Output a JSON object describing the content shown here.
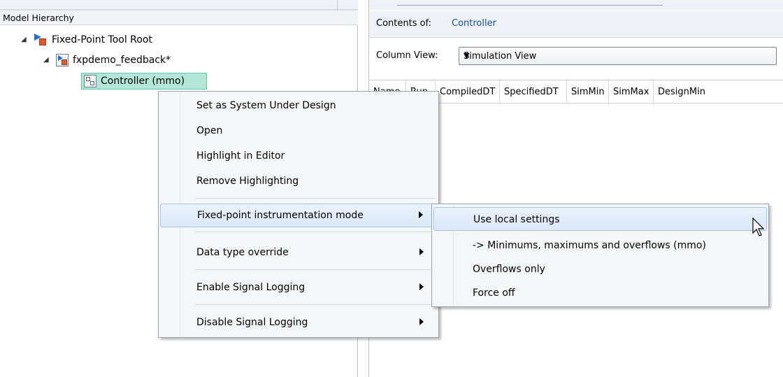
{
  "model_hierarchy": {
    "header": "Model Hierarchy",
    "nodes": [
      {
        "label": "Fixed-Point Tool Root"
      },
      {
        "label": "fxpdemo_feedback*"
      },
      {
        "label": "Controller (mmo)"
      }
    ]
  },
  "contents": {
    "label": "Contents of:",
    "value": "Controller"
  },
  "column_view": {
    "label": "Column View:",
    "selected": "Simulation View"
  },
  "table": {
    "columns": [
      "Name",
      "Run",
      "CompiledDT",
      "SpecifiedDT",
      "SimMin",
      "SimMax",
      "DesignMin"
    ]
  },
  "context_menu": {
    "items": [
      {
        "label": "Set as System Under Design",
        "submenu": false
      },
      {
        "label": "Open",
        "submenu": false
      },
      {
        "label": "Highlight in Editor",
        "submenu": false
      },
      {
        "label": "Remove Highlighting",
        "submenu": false
      },
      {
        "label": "Fixed-point instrumentation mode",
        "submenu": true
      },
      {
        "label": "Data type override",
        "submenu": true
      },
      {
        "label": "Enable Signal Logging",
        "submenu": true
      },
      {
        "label": "Disable Signal Logging",
        "submenu": true
      }
    ]
  },
  "submenu": {
    "items": [
      {
        "label": "Use local settings"
      },
      {
        "label": "-> Minimums, maximums and overflows (mmo)"
      },
      {
        "label": "Overflows only"
      },
      {
        "label": "Force off"
      }
    ]
  },
  "colors": {
    "selection": "#b2e7d7",
    "menu_highlight": "#dbe8f8",
    "link": "#1d4ea5"
  }
}
